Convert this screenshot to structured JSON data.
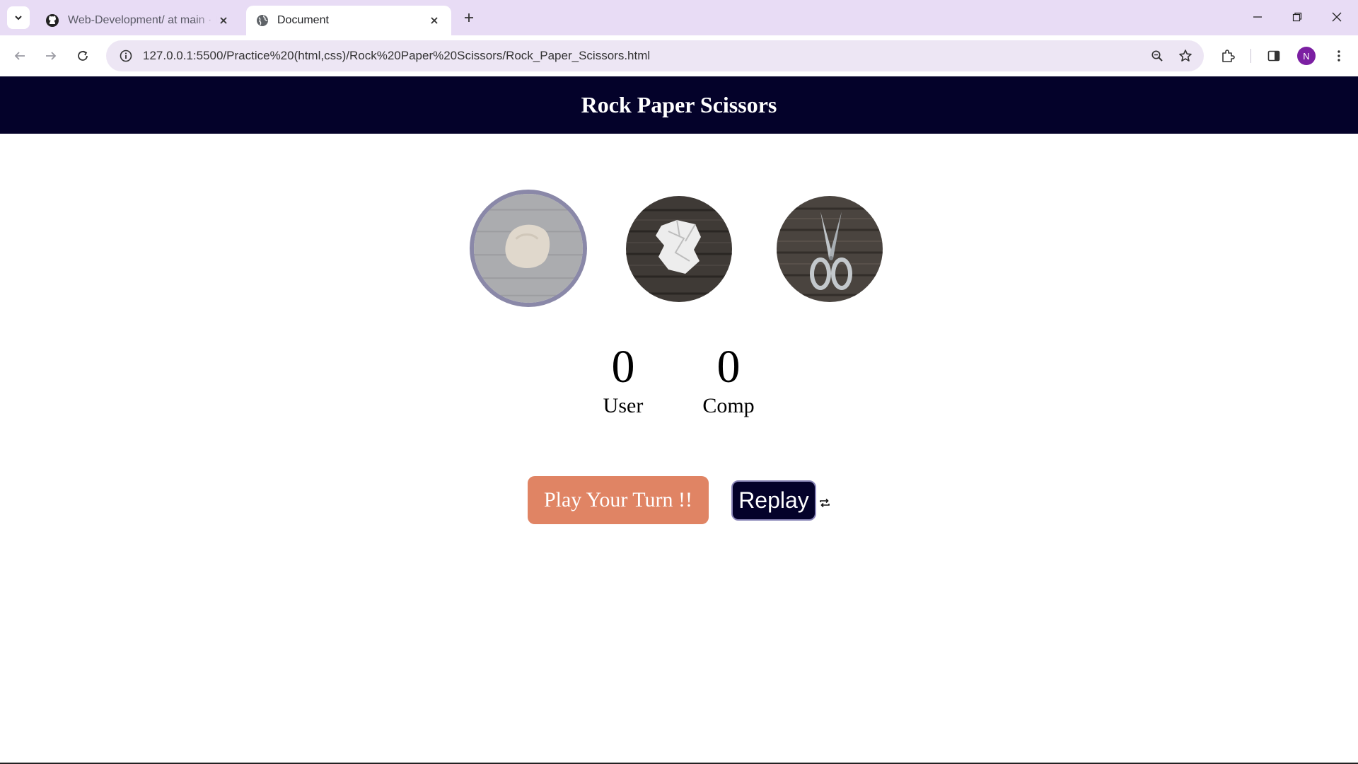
{
  "browser": {
    "tabs": [
      {
        "title": "Web-Development/ at main · N",
        "icon": "github-icon",
        "active": false
      },
      {
        "title": "Document",
        "icon": "globe-icon",
        "active": true
      }
    ],
    "url": "127.0.0.1:5500/Practice%20(html,css)/Rock%20Paper%20Scissors/Rock_Paper_Scissors.html",
    "profile_initial": "N",
    "profile_color": "#7b1fa2"
  },
  "app": {
    "title": "Rock Paper Scissors",
    "choices": [
      {
        "name": "rock",
        "selected": true
      },
      {
        "name": "paper",
        "selected": false
      },
      {
        "name": "scissors",
        "selected": false
      }
    ],
    "scores": {
      "user": {
        "value": "0",
        "label": "User"
      },
      "comp": {
        "value": "0",
        "label": "Comp"
      }
    },
    "play_label": "Play Your Turn !!",
    "replay_label": "Replay",
    "colors": {
      "header": "#04022a",
      "play_button": "#e08464",
      "replay_button": "#04022a",
      "selected_ring": "#8a88a8"
    }
  }
}
